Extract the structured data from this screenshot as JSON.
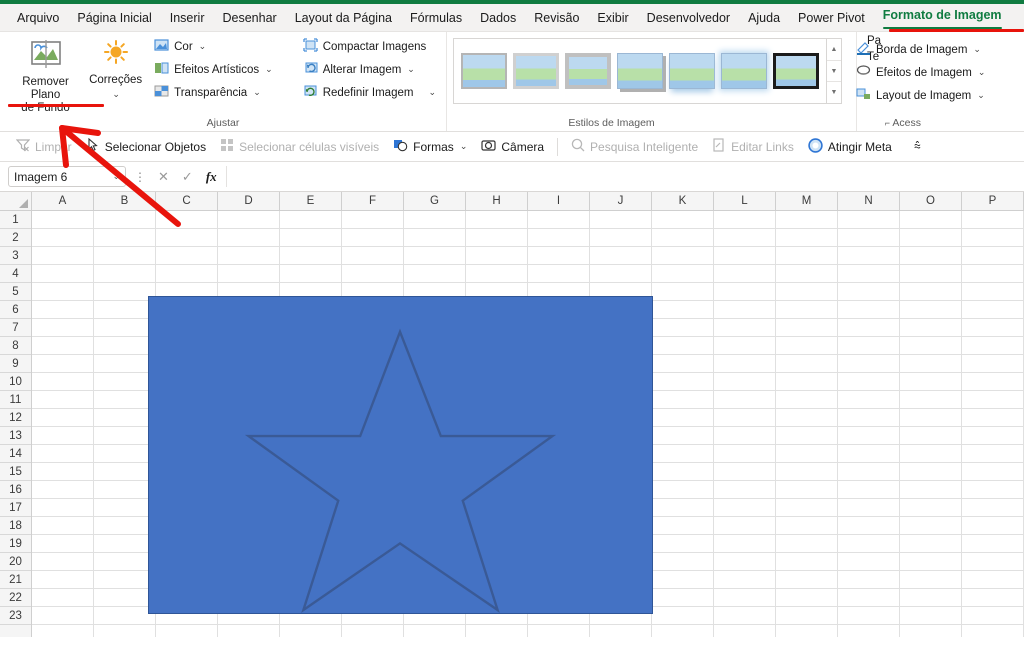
{
  "app": {
    "name": "Microsoft Excel",
    "accent_green": "#107c41",
    "annotation_red": "#e8140c"
  },
  "tabs": [
    {
      "label": "Arquivo",
      "active": false
    },
    {
      "label": "Página Inicial",
      "active": false
    },
    {
      "label": "Inserir",
      "active": false
    },
    {
      "label": "Desenhar",
      "active": false
    },
    {
      "label": "Layout da Página",
      "active": false
    },
    {
      "label": "Fórmulas",
      "active": false
    },
    {
      "label": "Dados",
      "active": false
    },
    {
      "label": "Revisão",
      "active": false
    },
    {
      "label": "Exibir",
      "active": false
    },
    {
      "label": "Desenvolvedor",
      "active": false
    },
    {
      "label": "Ajuda",
      "active": false
    },
    {
      "label": "Power Pivot",
      "active": false
    },
    {
      "label": "Formato de Imagem",
      "active": true
    }
  ],
  "ribbon": {
    "groups": [
      {
        "name": "ajustar",
        "label": "Ajustar",
        "big_buttons": [
          {
            "label": "Remover Plano\nde Fundo",
            "icon": "remove-background-icon",
            "annotated": true
          },
          {
            "label": "Correções",
            "icon": "corrections-sun-icon",
            "has_chevron": true
          }
        ],
        "small_buttons": [
          {
            "label": "Cor",
            "icon": "color-icon",
            "chevron": true
          },
          {
            "label": "Efeitos Artísticos",
            "icon": "artistic-effects-icon",
            "chevron": true
          },
          {
            "label": "Transparência",
            "icon": "transparency-icon",
            "chevron": true
          }
        ],
        "small_buttons_2": [
          {
            "label": "Compactar Imagens",
            "icon": "compress-pictures-icon",
            "chevron": false
          },
          {
            "label": "Alterar Imagem",
            "icon": "change-picture-icon",
            "chevron": true
          },
          {
            "label": "Redefinir Imagem",
            "icon": "reset-picture-icon",
            "chevron": true
          }
        ]
      },
      {
        "name": "estilos-de-imagem",
        "label": "Estilos de Imagem",
        "styles": [
          {
            "name": "simple-frame-white",
            "class": "f1"
          },
          {
            "name": "beveled-matte-white",
            "class": "f2"
          },
          {
            "name": "metal-frame",
            "class": "f3"
          },
          {
            "name": "drop-shadow-rectangle",
            "class": "f4"
          },
          {
            "name": "reflected-rounded-rectangle",
            "class": "f5"
          },
          {
            "name": "soft-edge-oval",
            "class": "f6"
          },
          {
            "name": "double-frame-black",
            "class": "f7"
          }
        ],
        "scroll_buttons": [
          "▲",
          "▼",
          "▼"
        ],
        "right_buttons": [
          {
            "label": "Borda de Imagem",
            "icon": "picture-border-icon",
            "chevron": true
          },
          {
            "label": "Efeitos de Imagem",
            "icon": "picture-effects-icon",
            "chevron": true
          },
          {
            "label": "Layout de Imagem",
            "icon": "picture-layout-icon",
            "chevron": true
          }
        ]
      },
      {
        "name": "acessibilidade",
        "label": "Acess",
        "cutoff_lines": [
          "Pa",
          "Te"
        ]
      }
    ]
  },
  "quickbar": {
    "items": [
      {
        "label": "Limpar",
        "icon": "clear-filter-icon",
        "disabled": true
      },
      {
        "label": "Selecionar Objetos",
        "icon": "select-objects-cursor-icon",
        "disabled": false
      },
      {
        "label": "Selecionar células visíveis",
        "icon": "select-visible-cells-icon",
        "disabled": true
      },
      {
        "label": "Formas",
        "icon": "shapes-icon",
        "disabled": false,
        "chevron": true
      },
      {
        "label": "Câmera",
        "icon": "camera-icon",
        "disabled": false
      },
      {
        "label": "Pesquisa Inteligente",
        "icon": "smart-lookup-icon",
        "disabled": true
      },
      {
        "label": "Editar Links",
        "icon": "edit-links-icon",
        "disabled": true
      },
      {
        "label": "Atingir Meta",
        "icon": "goal-seek-icon",
        "disabled": false
      }
    ],
    "overflow_label": "⩯"
  },
  "formula_bar": {
    "name_box_value": "Imagem 6",
    "name_box_chevron": "⌄",
    "cancel_label": "✕",
    "confirm_label": "✓",
    "fx_label": "fx",
    "formula_value": "",
    "formula_placeholder": ""
  },
  "grid": {
    "columns": [
      "A",
      "B",
      "C",
      "D",
      "E",
      "F",
      "G",
      "H",
      "I",
      "J",
      "K",
      "L",
      "M",
      "N",
      "O",
      "P"
    ],
    "rows": [
      1,
      2,
      3,
      4,
      5,
      6,
      7,
      8,
      9,
      10,
      11,
      12,
      13,
      14,
      15,
      16,
      17,
      18,
      19,
      20,
      21,
      22,
      23
    ],
    "selected_object": "Imagem 6"
  },
  "picture_object": {
    "name": "imagem-6",
    "fill_color": "#4472c4",
    "border_color": "#2f5597",
    "shape": "five-pointed-star-outline",
    "star_stroke": "#3a5a96"
  },
  "annotations": {
    "red_underline_tab": "Formato de Imagem",
    "red_underline_button": "Remover Plano de Fundo",
    "red_arrow": "points-to-remover-plano-de-fundo"
  }
}
